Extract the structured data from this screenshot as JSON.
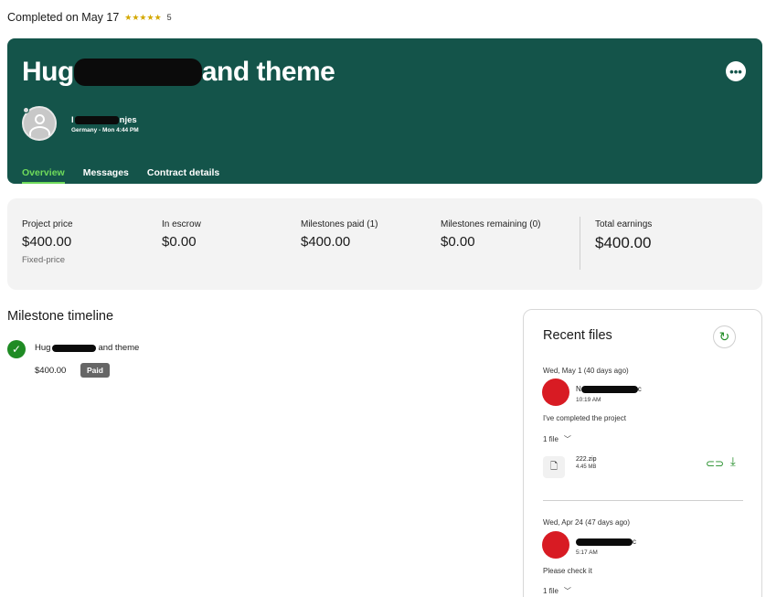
{
  "status": {
    "completed_text": "Completed on May 17",
    "stars": "★★★★★",
    "rating": "5"
  },
  "hero": {
    "title_prefix": "Hug",
    "title_suffix": "and theme",
    "more_icon": "•••",
    "user_name_prefix": "I",
    "user_name_suffix": "njes",
    "user_meta": "Germany - Mon 4:44 PM",
    "tabs": [
      {
        "label": "Overview",
        "active": true
      },
      {
        "label": "Messages",
        "active": false
      },
      {
        "label": "Contract details",
        "active": false
      }
    ]
  },
  "stats": [
    {
      "label": "Project price",
      "value": "$400.00",
      "sub": "Fixed-price"
    },
    {
      "label": "In escrow",
      "value": "$0.00"
    },
    {
      "label": "Milestones paid (1)",
      "value": "$400.00"
    },
    {
      "label": "Milestones remaining (0)",
      "value": "$0.00"
    },
    {
      "label": "Total earnings",
      "value": "$400.00"
    }
  ],
  "milestones": {
    "title": "Milestone timeline",
    "items": [
      {
        "name_prefix": "Hug",
        "name_suffix": "and theme",
        "amount": "$400.00",
        "status": "Paid"
      }
    ]
  },
  "recent_files": {
    "title": "Recent files",
    "entries": [
      {
        "date": "Wed, May 1  (40 days ago)",
        "sender_prefix": "N",
        "sender_suffix": "c",
        "time": "10:19 AM",
        "message": "I've completed the project",
        "file_count": "1 file",
        "file": {
          "name": "222.zip",
          "size": "4.45 MB"
        }
      },
      {
        "date": "Wed, Apr 24  (47 days ago)",
        "sender_prefix": "",
        "sender_suffix": "c",
        "time": "5:17 AM",
        "message": "Please check it",
        "file_count": "1 file"
      }
    ]
  },
  "colors": {
    "brand_dark_green": "#14544a",
    "accent_green": "#6fdb5b",
    "success_green": "#1f8b24"
  }
}
